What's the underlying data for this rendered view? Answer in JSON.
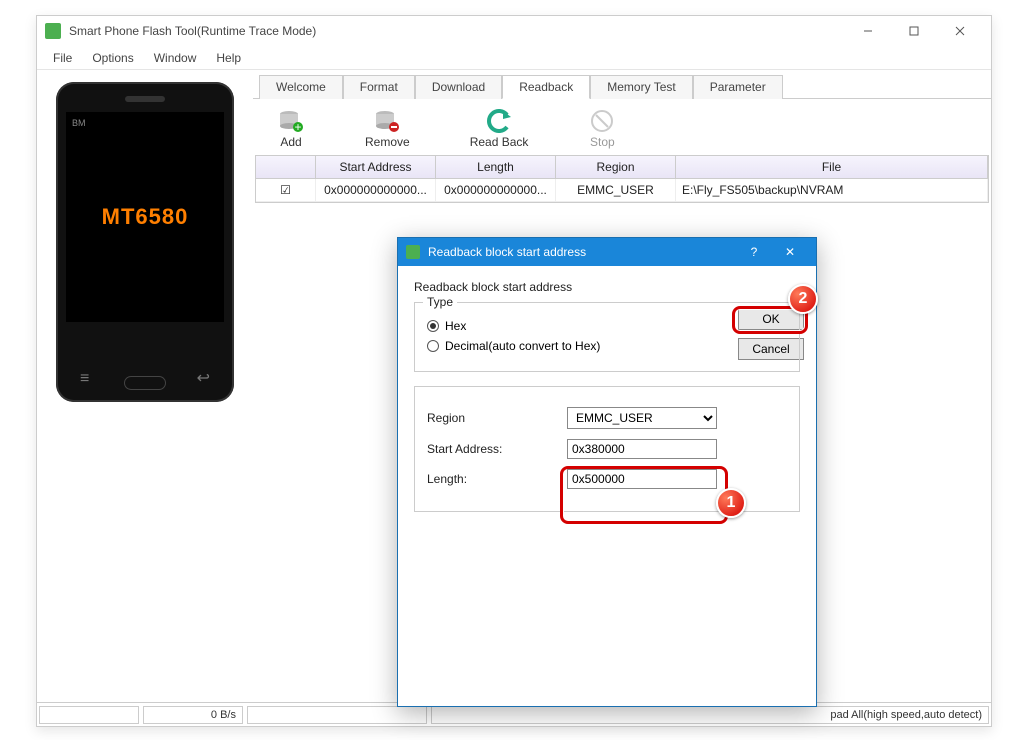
{
  "window": {
    "title": "Smart Phone Flash Tool(Runtime Trace Mode)"
  },
  "menu": {
    "file": "File",
    "options": "Options",
    "window": "Window",
    "help": "Help"
  },
  "phone": {
    "brand": "BM",
    "chip": "MT6580"
  },
  "tabs": {
    "welcome": "Welcome",
    "format": "Format",
    "download": "Download",
    "readback": "Readback",
    "memtest": "Memory Test",
    "parameter": "Parameter"
  },
  "toolbar": {
    "add": "Add",
    "remove": "Remove",
    "readback": "Read Back",
    "stop": "Stop"
  },
  "table": {
    "headers": {
      "start": "Start Address",
      "length": "Length",
      "region": "Region",
      "file": "File"
    },
    "row": {
      "checked": true,
      "start": "0x000000000000...",
      "length": "0x000000000000...",
      "region": "EMMC_USER",
      "file": "E:\\Fly_FS505\\backup\\NVRAM"
    }
  },
  "status": {
    "speed": "0 B/s",
    "mode": "pad All(high speed,auto detect)"
  },
  "dialog": {
    "title": "Readback block start address",
    "heading": "Readback block start address",
    "type_legend": "Type",
    "hex_label": "Hex",
    "dec_label": "Decimal(auto convert to Hex)",
    "region_label": "Region",
    "region_value": "EMMC_USER",
    "start_label": "Start Address:",
    "start_value": "0x380000",
    "length_label": "Length:",
    "length_value": "0x500000",
    "ok": "OK",
    "cancel": "Cancel"
  },
  "badges": {
    "one": "1",
    "two": "2"
  }
}
